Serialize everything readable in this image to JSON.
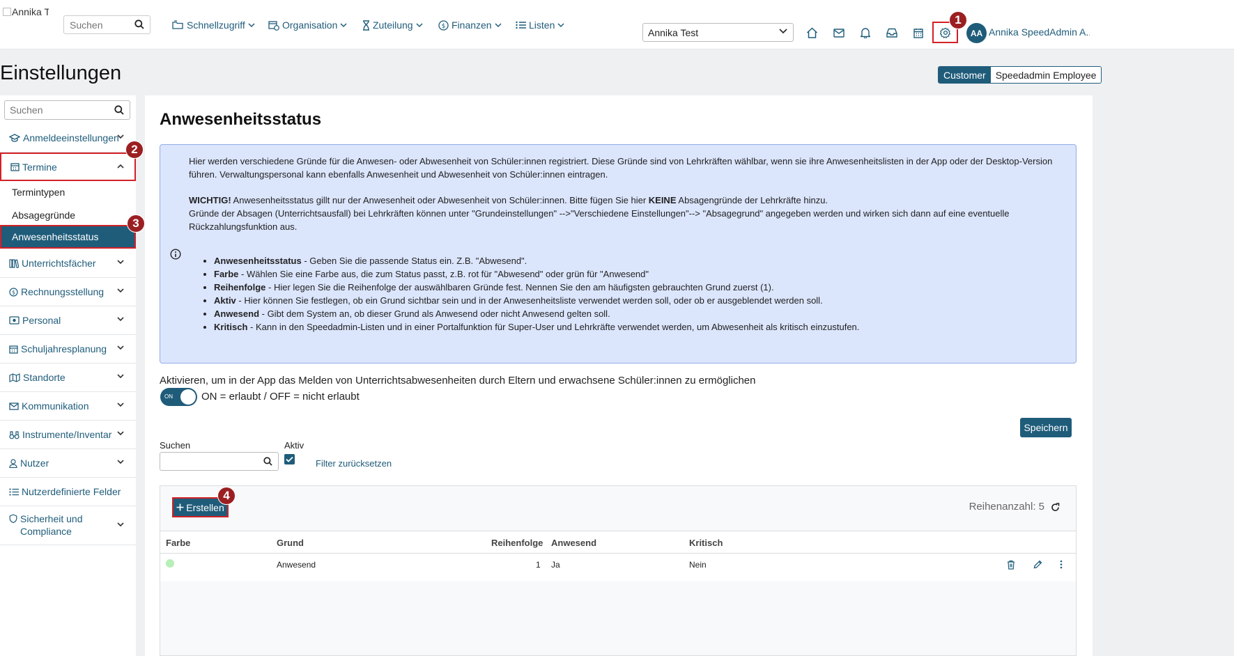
{
  "header": {
    "logo_text": "Annika Testschule",
    "search_placeholder": "Suchen",
    "nav": [
      {
        "label": "Schnellzugriff"
      },
      {
        "label": "Organisation"
      },
      {
        "label": "Zuteilung"
      },
      {
        "label": "Finanzen"
      },
      {
        "label": "Listen"
      }
    ],
    "client_select": "Annika Test",
    "avatar_initials": "AA",
    "user_name": "Annika SpeedAdmin A..."
  },
  "markers": [
    "1",
    "2",
    "3",
    "4"
  ],
  "page_title": "Einstellungen",
  "role_toggle": {
    "active": "Customer",
    "inactive": "Speedadmin Employee"
  },
  "sidebar": {
    "search_placeholder": "Suchen",
    "items": [
      {
        "label": "Anmeldeeinstellungen"
      },
      {
        "label": "Termine"
      },
      {
        "label": "Unterrichtsfächer"
      },
      {
        "label": "Rechnungsstellung"
      },
      {
        "label": "Personal"
      },
      {
        "label": "Schuljahresplanung"
      },
      {
        "label": "Standorte"
      },
      {
        "label": "Kommunikation"
      },
      {
        "label": "Instrumente/Inventar"
      },
      {
        "label": "Nutzer"
      },
      {
        "label": "Nutzerdefinierte Felder"
      },
      {
        "label": "Sicherheit und Compliance"
      }
    ],
    "sub_items": [
      {
        "label": "Termintypen"
      },
      {
        "label": "Absagegründe"
      },
      {
        "label": "Anwesenheitsstatus"
      }
    ]
  },
  "main": {
    "title": "Anwesenheitsstatus",
    "info": {
      "p1": "Hier werden verschiedene Gründe für die Anwesen- oder Abwesenheit von Schüler:innen registriert. Diese Gründe sind von Lehrkräften wählbar, wenn sie ihre Anwesenheitslisten in der App oder der Desktop-Version führen. Verwaltungspersonal kann ebenfalls Anwesenheit und Abwesenheit von Schüler:innen eintragen.",
      "p2_strong": "WICHTIG!",
      "p2_a": " Anwesenheitsstatus gillt nur der Anwesenheit oder Abwesenheit von Schüler:innen. Bitte fügen Sie hier ",
      "p2_strong2": "KEINE",
      "p2_b": " Absagengründe der Lehrkräfte hinzu.",
      "p3": "Gründe der Absagen (Unterrichtsausfall) bei Lehrkräften können unter \"Grundeinstellungen\" -->\"Verschiedene Einstellungen\"--> \"Absagegrund\" angegeben werden und wirken sich dann auf eine eventuelle Rückzahlungsfunktion aus.",
      "bullets": [
        {
          "term": "Anwesenheitsstatus",
          "text": " - Geben Sie die passende Status ein. Z.B. \"Abwesend\"."
        },
        {
          "term": "Farbe",
          "text": " - Wählen Sie eine Farbe aus, die zum Status passt, z.B. rot für  \"Abwesend\" oder grün für \"Anwesend\""
        },
        {
          "term": "Reihenfolge",
          "text": " - Hier legen Sie die Reihenfolge der auswählbaren Gründe fest. Nennen Sie den am häufigsten gebrauchten Grund zuerst (1)."
        },
        {
          "term": "Aktiv",
          "text": " - Hier können Sie festlegen, ob ein Grund sichtbar sein und in der Anwesenheitsliste verwendet werden soll, oder ob er ausgeblendet werden soll."
        },
        {
          "term": "Anwesend",
          "text": " - Gibt dem System an, ob dieser Grund als Anwesend oder nicht Anwesend gelten soll."
        },
        {
          "term": "Kritisch",
          "text": " - Kann in den Speedadmin-Listen und in einer Portalfunktion für Super-User und Lehrkräfte verwendet werden, um Abwesenheit als kritisch einzustufen."
        }
      ]
    },
    "toggle_label": "Aktivieren, um in der App das Melden von Unterrichtsabwesenheiten durch Eltern und erwachsene Schüler:innen zu ermöglichen",
    "toggle_state": "ON",
    "toggle_desc": "ON = erlaubt / OFF = nicht erlaubt",
    "save_label": "Speichern",
    "filter": {
      "search_label": "Suchen",
      "search_value": "",
      "active_label": "Aktiv",
      "active_checked": true,
      "reset_label": "Filter zurücksetzen"
    },
    "table": {
      "create_label": "Erstellen",
      "row_count": "Reihenanzahl: 5",
      "columns": [
        "Farbe",
        "Grund",
        "Reihenfolge",
        "Anwesend",
        "Kritisch"
      ],
      "rows": [
        {
          "color": "#b7efb8",
          "grund": "Anwesend",
          "reihenfolge": "1",
          "anwesend": "Ja",
          "kritisch": "Nein"
        }
      ]
    }
  },
  "colors": {
    "primary": "#1f5c7a",
    "highlight": "#d42026",
    "marker": "#9b1f22",
    "info_bg": "#dbe5fc"
  }
}
